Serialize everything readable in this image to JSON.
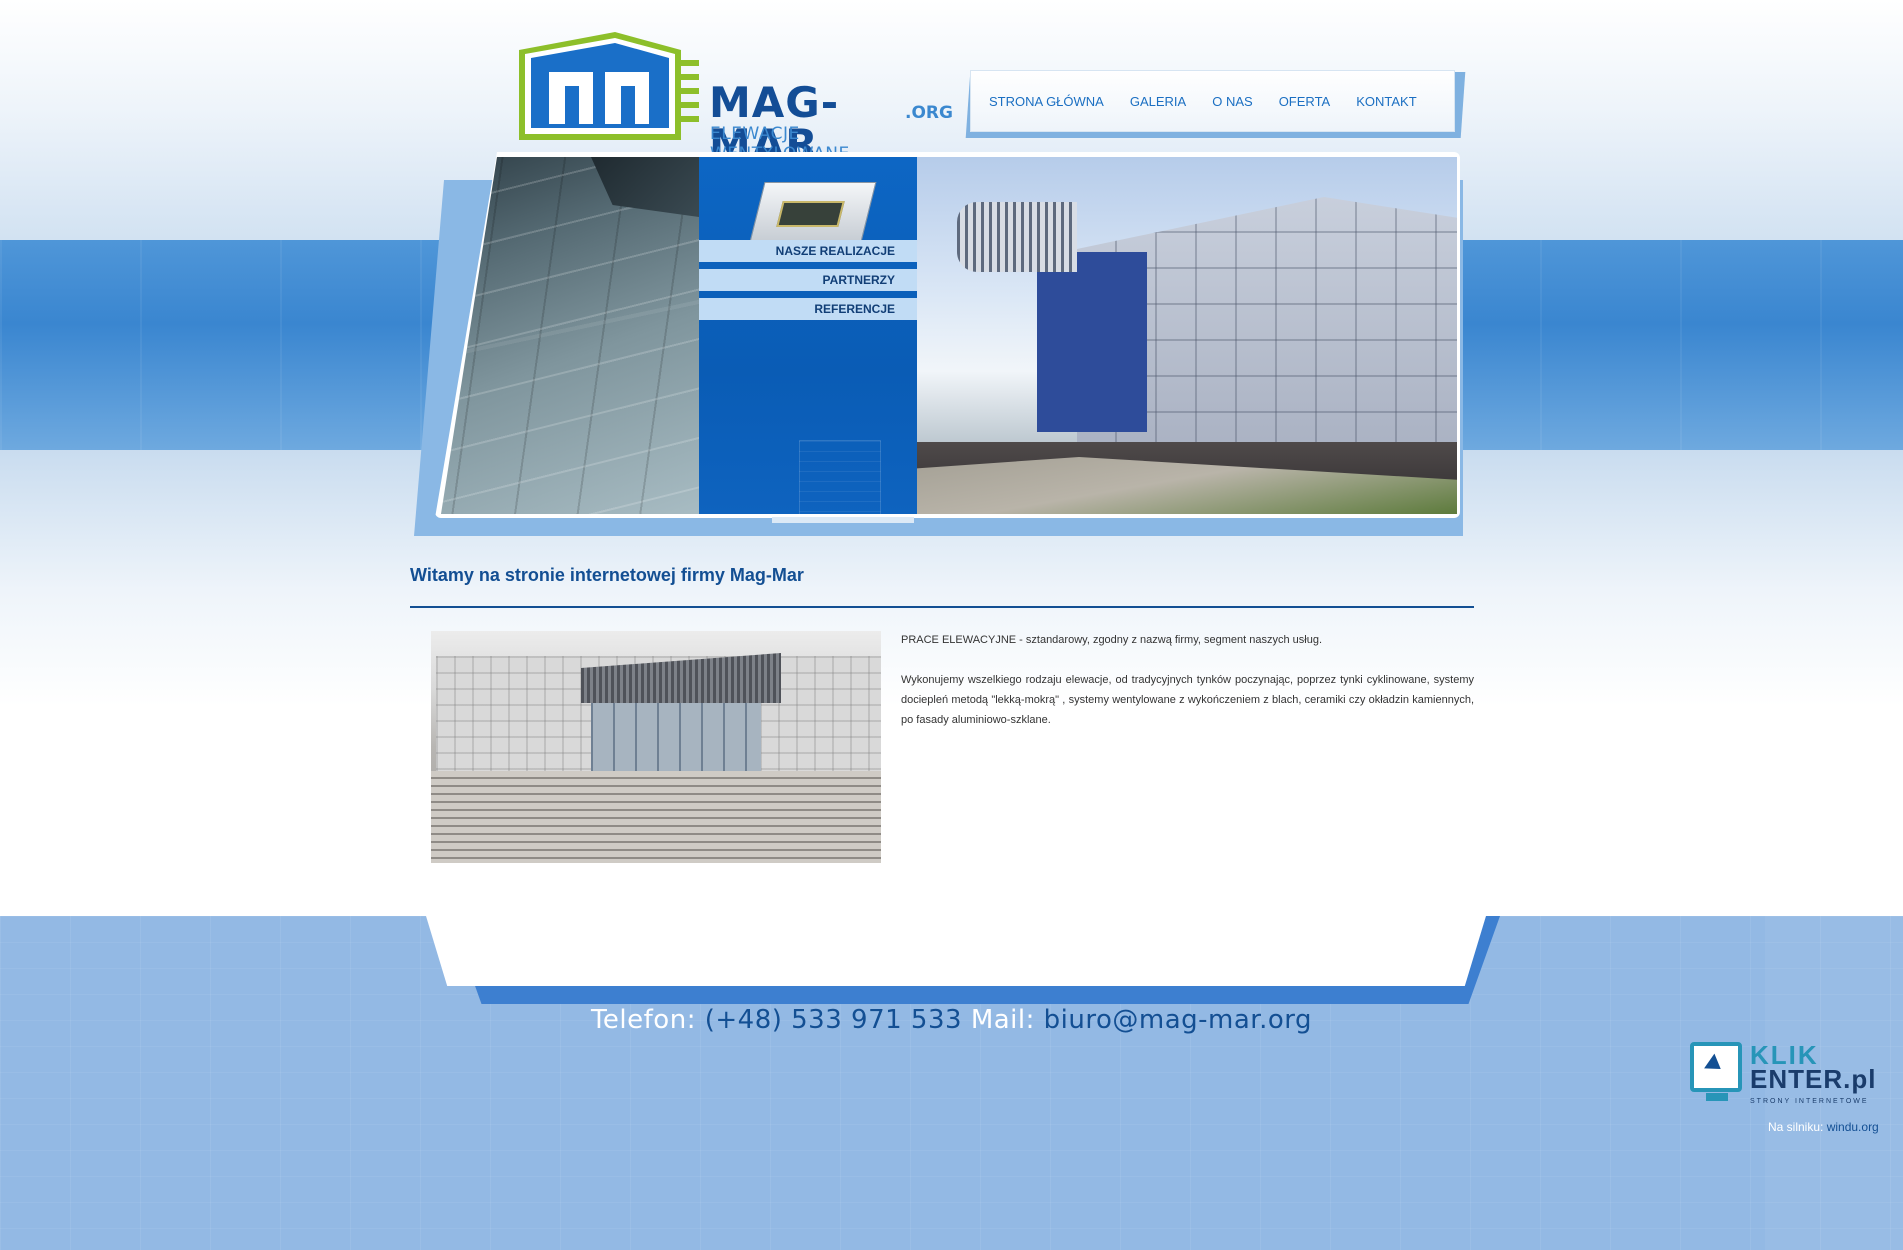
{
  "logo": {
    "title": "MAG-MAR",
    "tld": ".ORG",
    "subtitle": "ELEWACJE WENTYLOWANE",
    "icon": "building-logo-icon"
  },
  "topnav": {
    "items": [
      "STRONA GŁÓWNA",
      "GALERIA",
      "O NAS",
      "OFERTA",
      "KONTAKT"
    ]
  },
  "banner": {
    "menu": [
      "NASZE REALIZACJE",
      "PARTNERZY",
      "REFERENCJE"
    ]
  },
  "content": {
    "heading": "Witamy na stronie internetowej firmy Mag-Mar",
    "paragraphs": [
      "PRACE ELEWACYJNE - sztandarowy, zgodny z nazwą firmy, segment naszych usług.",
      "Wykonujemy wszelkiego rodzaju elewacje, od tradycyjnych tynków poczynając, poprzez tynki cyklinowane, systemy dociepleń metodą \"lekką-mokrą\" , systemy wentylowane z wykończeniem z blach, ceramiki czy okładzin kamiennych, po fasady aluminiowo-szklane."
    ]
  },
  "footer": {
    "phone_label": "Telefon:",
    "phone": "(+48) 533 971 533",
    "mail_label": "Mail:",
    "mail": "biuro@mag-mar.org",
    "badge": {
      "word1": "KLIK",
      "word2": "ENTER.pl",
      "tagline": "STRONY INTERNETOWE"
    },
    "engine_label": "Na silniku:",
    "engine_link": "windu.org"
  },
  "colors": {
    "brand_dark": "#134f93",
    "brand_light": "#3b88cf",
    "menu_bar": "#c1dcf5",
    "footer_bg": "#93b9e4"
  }
}
